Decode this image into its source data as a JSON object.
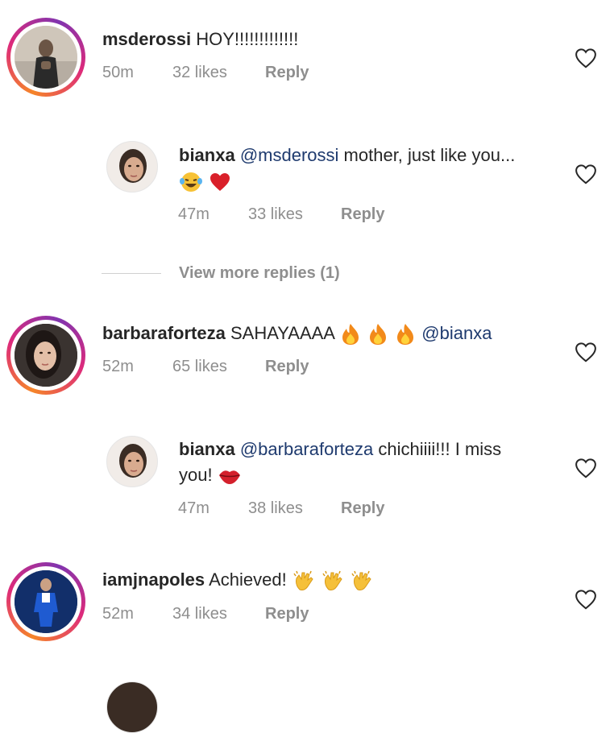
{
  "comments": [
    {
      "username": "msderossi",
      "text": "HOY!!!!!!!!!!!!!",
      "time": "50m",
      "likes": "32 likes",
      "reply": "Reply",
      "avatar_icon": "person-avatar"
    },
    {
      "username": "bianxa",
      "mention": "@msderossi",
      "text": "mother, just like you...",
      "emojis": [
        "laughing-crying-emoji",
        "red-heart-emoji"
      ],
      "time": "47m",
      "likes": "33 likes",
      "reply": "Reply",
      "avatar_icon": "person-avatar"
    },
    {
      "username": "barbaraforteza",
      "text": "SAHAYAAAA",
      "emojis": [
        "fire-emoji",
        "fire-emoji",
        "fire-emoji"
      ],
      "mention": "@bianxa",
      "time": "52m",
      "likes": "65 likes",
      "reply": "Reply",
      "avatar_icon": "person-avatar"
    },
    {
      "username": "bianxa",
      "mention": "@barbaraforteza",
      "text": "chichiiii!!! I miss",
      "text2": "you!",
      "emojis": [
        "lips-emoji"
      ],
      "time": "47m",
      "likes": "38 likes",
      "reply": "Reply",
      "avatar_icon": "person-avatar"
    },
    {
      "username": "iamjnapoles",
      "text": "Achieved!",
      "emojis": [
        "clapping-hands-emoji",
        "clapping-hands-emoji",
        "clapping-hands-emoji"
      ],
      "time": "52m",
      "likes": "34 likes",
      "reply": "Reply",
      "avatar_icon": "person-avatar"
    }
  ],
  "view_more": "View more replies (1)",
  "colors": {
    "username": "#262626",
    "mention": "#1e3a6e",
    "meta": "#8e8e8e",
    "story_ring": "#dd2a7b"
  }
}
